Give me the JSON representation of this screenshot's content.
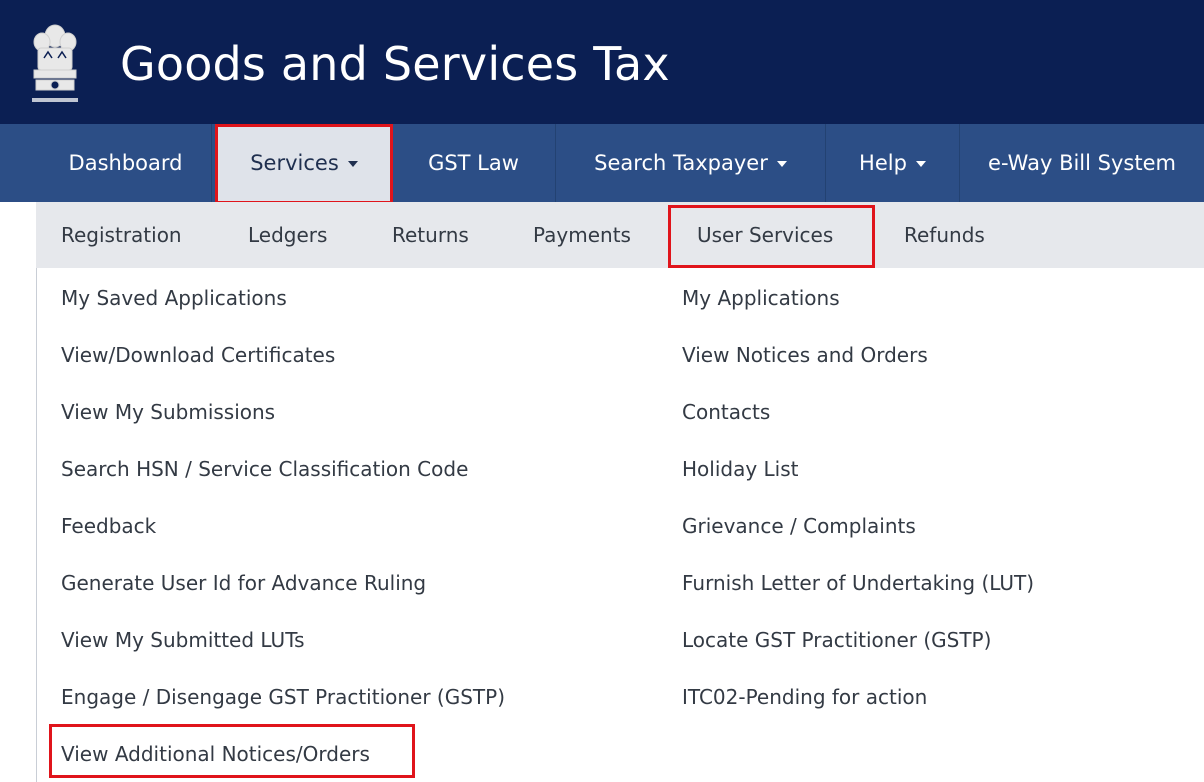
{
  "header": {
    "title": "Goods and Services Tax"
  },
  "nav": {
    "dashboard": "Dashboard",
    "services": "Services",
    "gst_law": "GST Law",
    "search_taxpayer": "Search Taxpayer",
    "help": "Help",
    "eway": "e-Way Bill System"
  },
  "subnav": {
    "registration": "Registration",
    "ledgers": "Ledgers",
    "returns": "Returns",
    "payments": "Payments",
    "user_services": "User Services",
    "refunds": "Refunds"
  },
  "menu": {
    "left": [
      "My Saved Applications",
      "View/Download Certificates",
      "View My Submissions",
      "Search HSN / Service Classification Code",
      "Feedback",
      "Generate User Id for Advance Ruling",
      "View My Submitted LUTs",
      "Engage / Disengage GST Practitioner (GSTP)",
      "View Additional Notices/Orders"
    ],
    "right": [
      "My Applications",
      "View Notices and Orders",
      "Contacts",
      "Holiday List",
      "Grievance / Complaints",
      "Furnish Letter of Undertaking (LUT)",
      "Locate GST Practitioner (GSTP)",
      "ITC02-Pending for action"
    ]
  },
  "colors": {
    "header_bg": "#0b1f53",
    "nav_bg": "#2c4e86",
    "active_bg": "#dfe3ea",
    "highlight": "#e0141b"
  },
  "icons": {
    "emblem": "national-emblem-icon"
  }
}
